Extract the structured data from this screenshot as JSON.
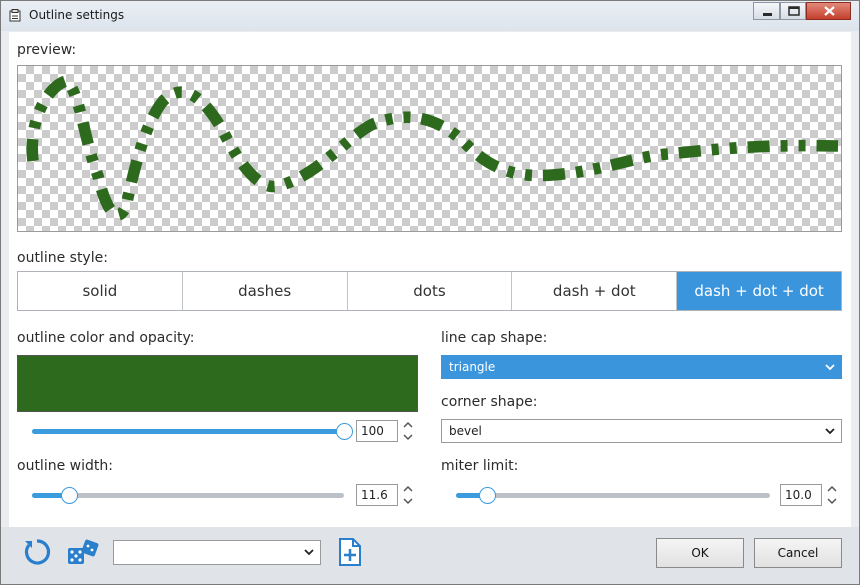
{
  "window": {
    "title": "Outline settings",
    "controls": [
      "minimize-icon",
      "maximize-icon",
      "close-icon"
    ]
  },
  "preview": {
    "label": "preview:",
    "stroke_color": "#2d6a1e"
  },
  "outline_style": {
    "label": "outline style:",
    "options": [
      "solid",
      "dashes",
      "dots",
      "dash + dot",
      "dash + dot + dot"
    ],
    "selected": "dash + dot + dot"
  },
  "color": {
    "label": "outline color and opacity:",
    "value": "#2d6a1e",
    "opacity": "100",
    "opacity_fraction": 1.0
  },
  "width": {
    "label": "outline width:",
    "value": "11.6",
    "fraction": 0.12
  },
  "line_cap": {
    "label": "line cap shape:",
    "value": "triangle"
  },
  "corner": {
    "label": "corner shape:",
    "value": "bevel"
  },
  "miter": {
    "label": "miter limit:",
    "value": "10.0",
    "fraction": 0.1
  },
  "footer": {
    "preset_value": "",
    "ok_label": "OK",
    "cancel_label": "Cancel",
    "icons": [
      "reset-icon",
      "random-dice-icon",
      "add-preset-icon"
    ]
  },
  "colors": {
    "accent": "#3a95dc",
    "outline": "#2d6a1e"
  }
}
